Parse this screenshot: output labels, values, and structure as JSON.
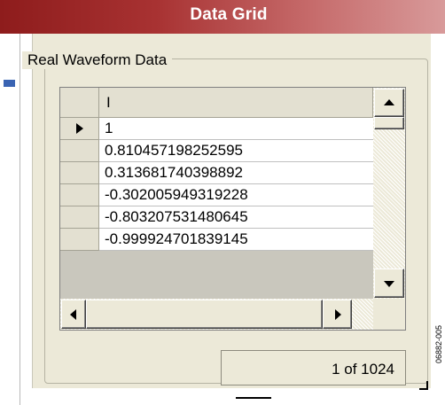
{
  "window": {
    "title": "Data Grid"
  },
  "group": {
    "label": "Real Waveform Data"
  },
  "grid": {
    "column_header": "I",
    "rows": [
      "1",
      "0.810457198252595",
      "0.313681740398892",
      "-0.302005949319228",
      "-0.803207531480645",
      "-0.999924701839145"
    ],
    "selected_row": 0
  },
  "counter": {
    "text": "1 of 1024"
  },
  "side_code": "06882-005",
  "icons": {
    "scroll_up": "arrow-up-icon",
    "scroll_down": "arrow-down-icon",
    "scroll_left": "arrow-left-icon",
    "scroll_right": "arrow-right-icon",
    "current_row": "row-pointer-icon",
    "resize_grip": "resize-grip-icon"
  },
  "colors": {
    "titlebar_start": "#8e1c1c",
    "titlebar_end": "#d89a9a",
    "window_bg": "#ece9d8",
    "cell_bg": "#ffffff"
  }
}
